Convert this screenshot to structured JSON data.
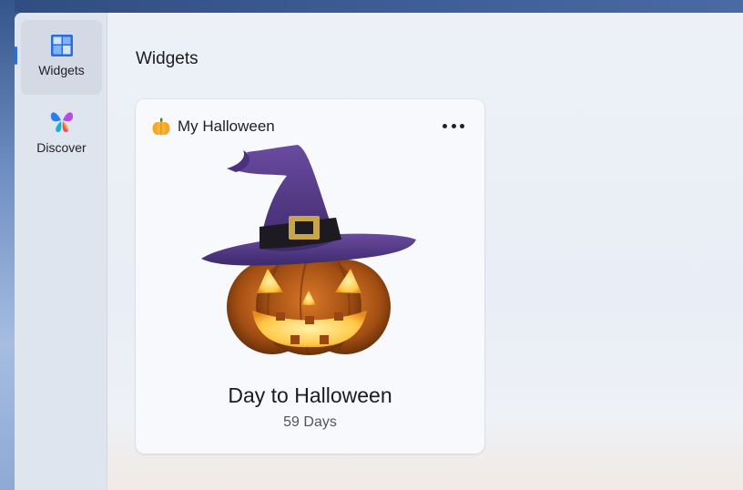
{
  "sidebar": {
    "items": [
      {
        "label": "Widgets",
        "icon": "widgets-icon",
        "active": true
      },
      {
        "label": "Discover",
        "icon": "discover-icon",
        "active": false
      }
    ]
  },
  "page": {
    "title": "Widgets"
  },
  "widget": {
    "title": "My Halloween",
    "icon": "pumpkin-icon",
    "headline": "Day to Halloween",
    "countdown": "59 Days",
    "more_icon": "more-options-icon"
  },
  "colors": {
    "accent": "#2f6fd1",
    "hat_purple": "#5b3e8c",
    "pumpkin_orange": "#c96a1e",
    "glow": "#ffcf5a"
  }
}
